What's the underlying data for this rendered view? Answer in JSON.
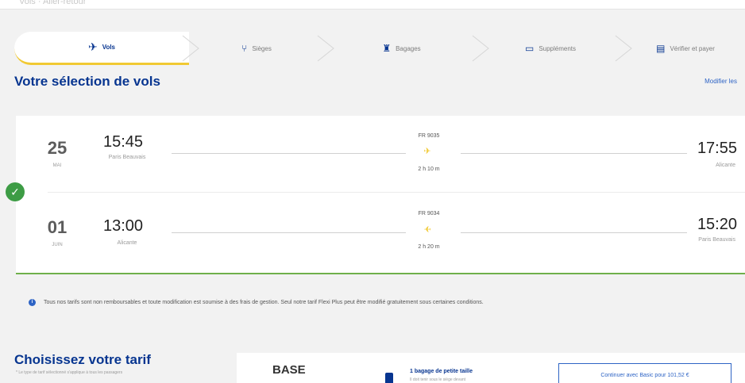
{
  "header": {
    "faint_text": "Vols · Aller-retour"
  },
  "stepper": {
    "steps": [
      {
        "label": "Vols",
        "icon": "plane-icon"
      },
      {
        "label": "Sièges",
        "icon": "seat-icon"
      },
      {
        "label": "Bagages",
        "icon": "luggage-icon"
      },
      {
        "label": "Suppléments",
        "icon": "laptop-icon"
      },
      {
        "label": "Vérifier et payer",
        "icon": "card-icon"
      }
    ]
  },
  "selection": {
    "title": "Votre sélection de vols",
    "modify_link": "Modifier les"
  },
  "flights": [
    {
      "day": "25",
      "month": "MAI",
      "dep_time": "15:45",
      "dep_city": "Paris Beauvais",
      "flight_no": "FR 9035",
      "duration": "2 h 10 m",
      "arr_time": "17:55",
      "arr_city": "Alicante"
    },
    {
      "day": "01",
      "month": "JUIN",
      "dep_time": "13:00",
      "dep_city": "Alicante",
      "flight_no": "FR 9034",
      "duration": "2 h 20 m",
      "arr_time": "15:20",
      "arr_city": "Paris Beauvais"
    }
  ],
  "notice": {
    "text": "Tous nos tarifs sont non remboursables et toute modification est soumise à des frais de gestion. Seul notre tarif Flexi Plus peut être modifié gratuitement sous certaines conditions."
  },
  "fare": {
    "title": "Choisissez votre tarif",
    "note": "* Le type de tarif sélectionné s'applique à tous les passagers",
    "name": "BASE",
    "bag_title": "1 bagage de petite taille",
    "bag_sub": "Il doit tenir sous le siège devant",
    "continue_label": "Continuer avec Basic pour 101,52 €"
  },
  "colors": {
    "brand": "#073590",
    "accent": "#f1c933",
    "success": "#3d9c45",
    "link": "#2e64c5"
  }
}
